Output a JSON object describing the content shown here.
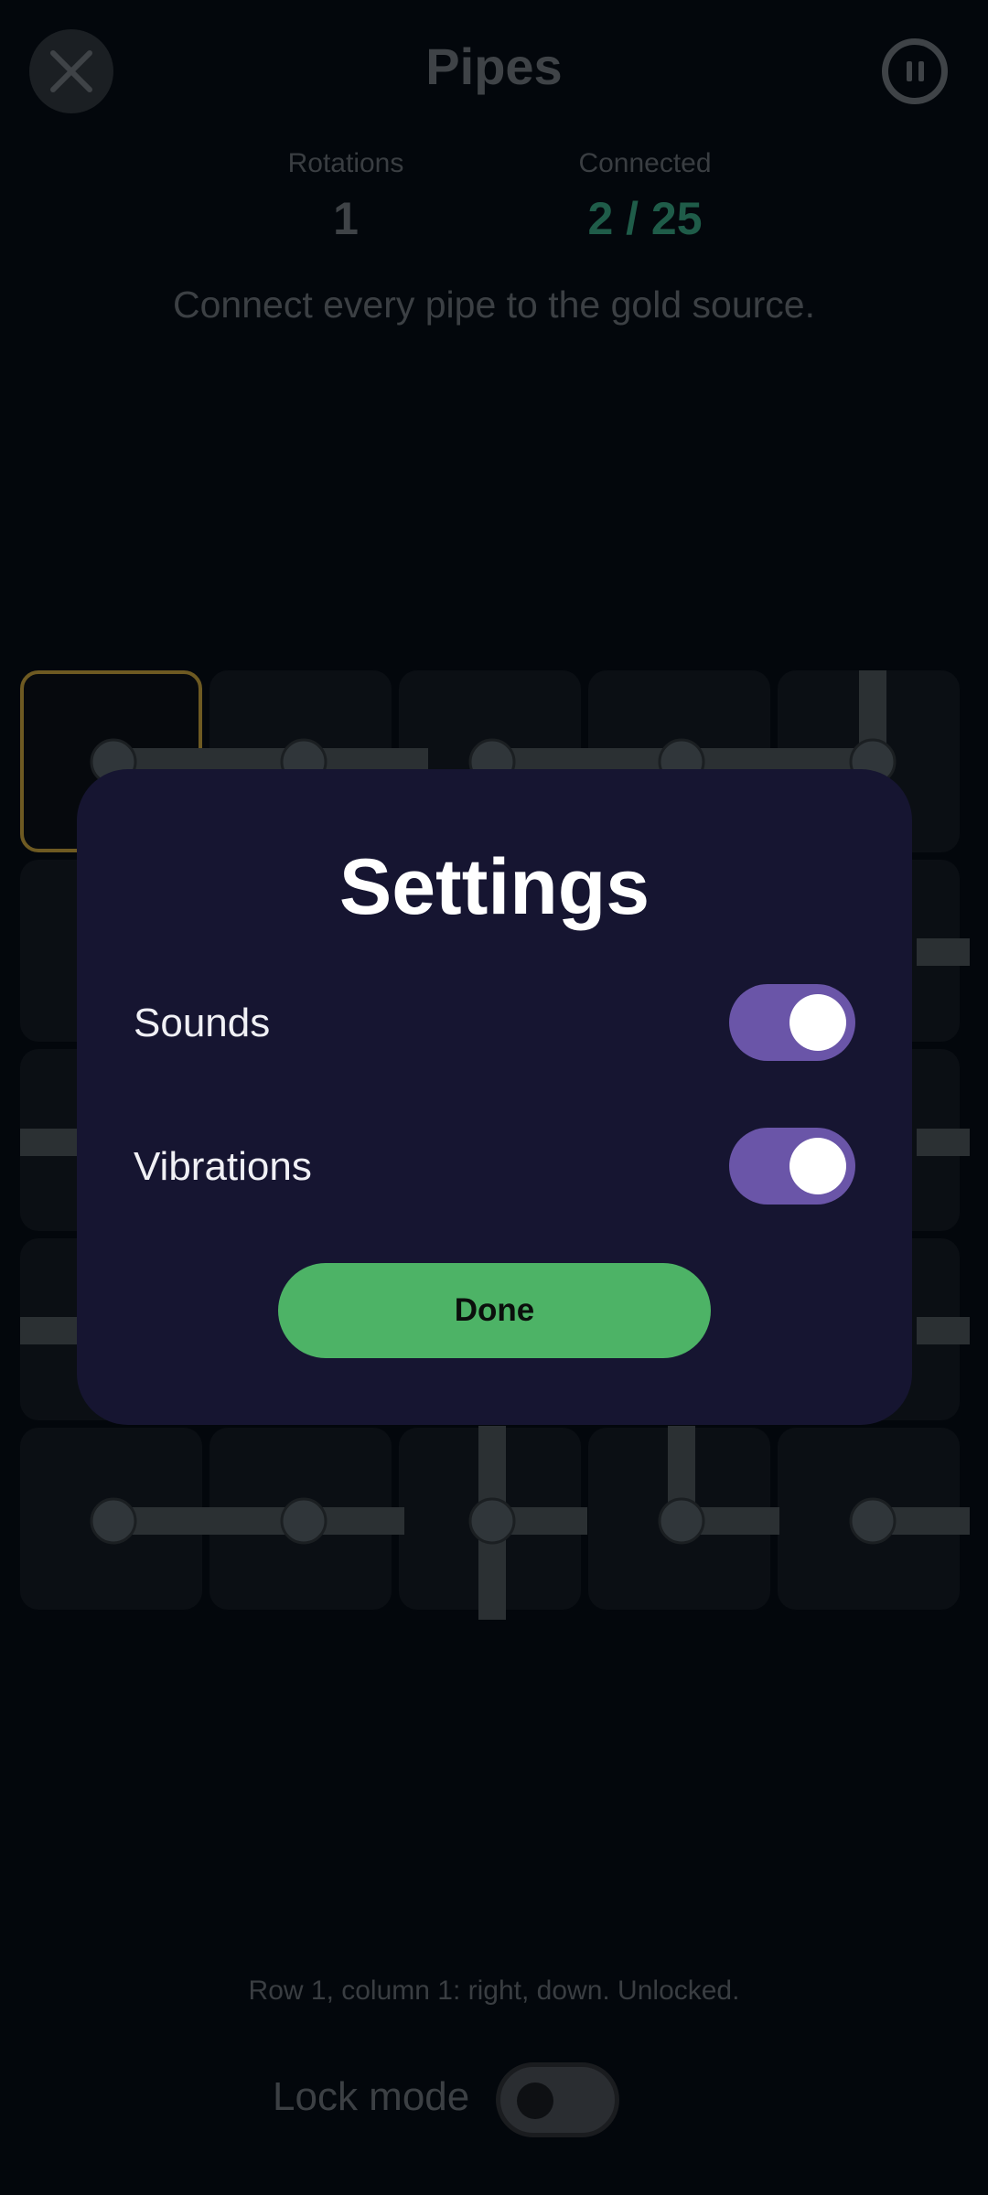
{
  "header": {
    "title": "Pipes",
    "close_icon": "close-icon",
    "pause_icon": "pause-icon"
  },
  "stats": {
    "rotations_label": "Rotations",
    "rotations_value": "1",
    "connected_label": "Connected",
    "connected_value": "2 / 25"
  },
  "hint": "Connect every pipe to the gold source.",
  "colors": {
    "connected_accent": "#1f5c49",
    "source_border": "#6e5a22",
    "toggle_on": "#6a55a8",
    "done_button": "#4db366"
  },
  "board": {
    "rows": 5,
    "columns": 5,
    "selected_cell": "row 1, column 1"
  },
  "status": "Row 1, column 1: right, down. Unlocked.",
  "lock_mode": {
    "label": "Lock mode",
    "enabled": false
  },
  "settings_dialog": {
    "title": "Settings",
    "sounds_label": "Sounds",
    "sounds_enabled": true,
    "vibrations_label": "Vibrations",
    "vibrations_enabled": true,
    "done_label": "Done"
  }
}
